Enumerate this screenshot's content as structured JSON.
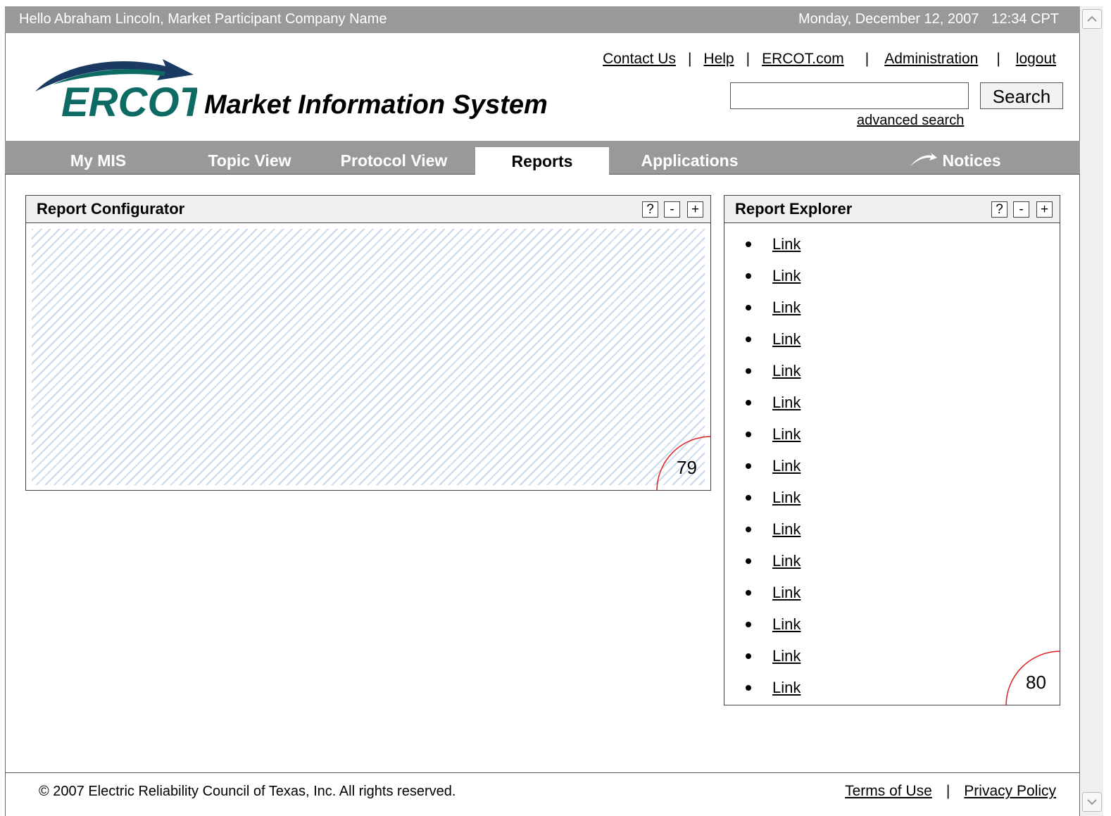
{
  "topbar": {
    "greeting": "Hello Abraham Lincoln, Market Participant Company Name",
    "date": "Monday, December 12, 2007",
    "time": "12:34 CPT"
  },
  "header": {
    "logo_text": "ERCOT",
    "title": "Market Information System",
    "links": [
      "Contact Us",
      "Help",
      "ERCOT.com",
      "Administration",
      "logout"
    ],
    "link_separator": "|",
    "search_placeholder": "",
    "search_button": "Search",
    "advanced_search": "advanced search"
  },
  "nav": {
    "tabs": [
      "My MIS",
      "Topic View",
      "Protocol View",
      "Reports",
      "Applications"
    ],
    "active_tab": "Reports",
    "notices": "Notices"
  },
  "report_configurator": {
    "title": "Report Configurator",
    "buttons": [
      "?",
      "-",
      "+"
    ],
    "badge": "79"
  },
  "report_explorer": {
    "title": "Report Explorer",
    "buttons": [
      "?",
      "-",
      "+"
    ],
    "links": [
      "Link",
      "Link",
      "Link",
      "Link",
      "Link",
      "Link",
      "Link",
      "Link",
      "Link",
      "Link",
      "Link",
      "Link",
      "Link",
      "Link",
      "Link"
    ],
    "badge": "80"
  },
  "footer": {
    "copyright": "© 2007 Electric Reliability Council of Texas, Inc.  All rights reserved.",
    "links": [
      "Terms of Use",
      "Privacy Policy"
    ],
    "separator": "|"
  },
  "colors": {
    "bar_gray": "#999999",
    "logo_teal": "#0e6b63",
    "logo_navy": "#1b3a63",
    "badge_red": "#e02020",
    "hatch_blue": "#c9d8ee"
  }
}
